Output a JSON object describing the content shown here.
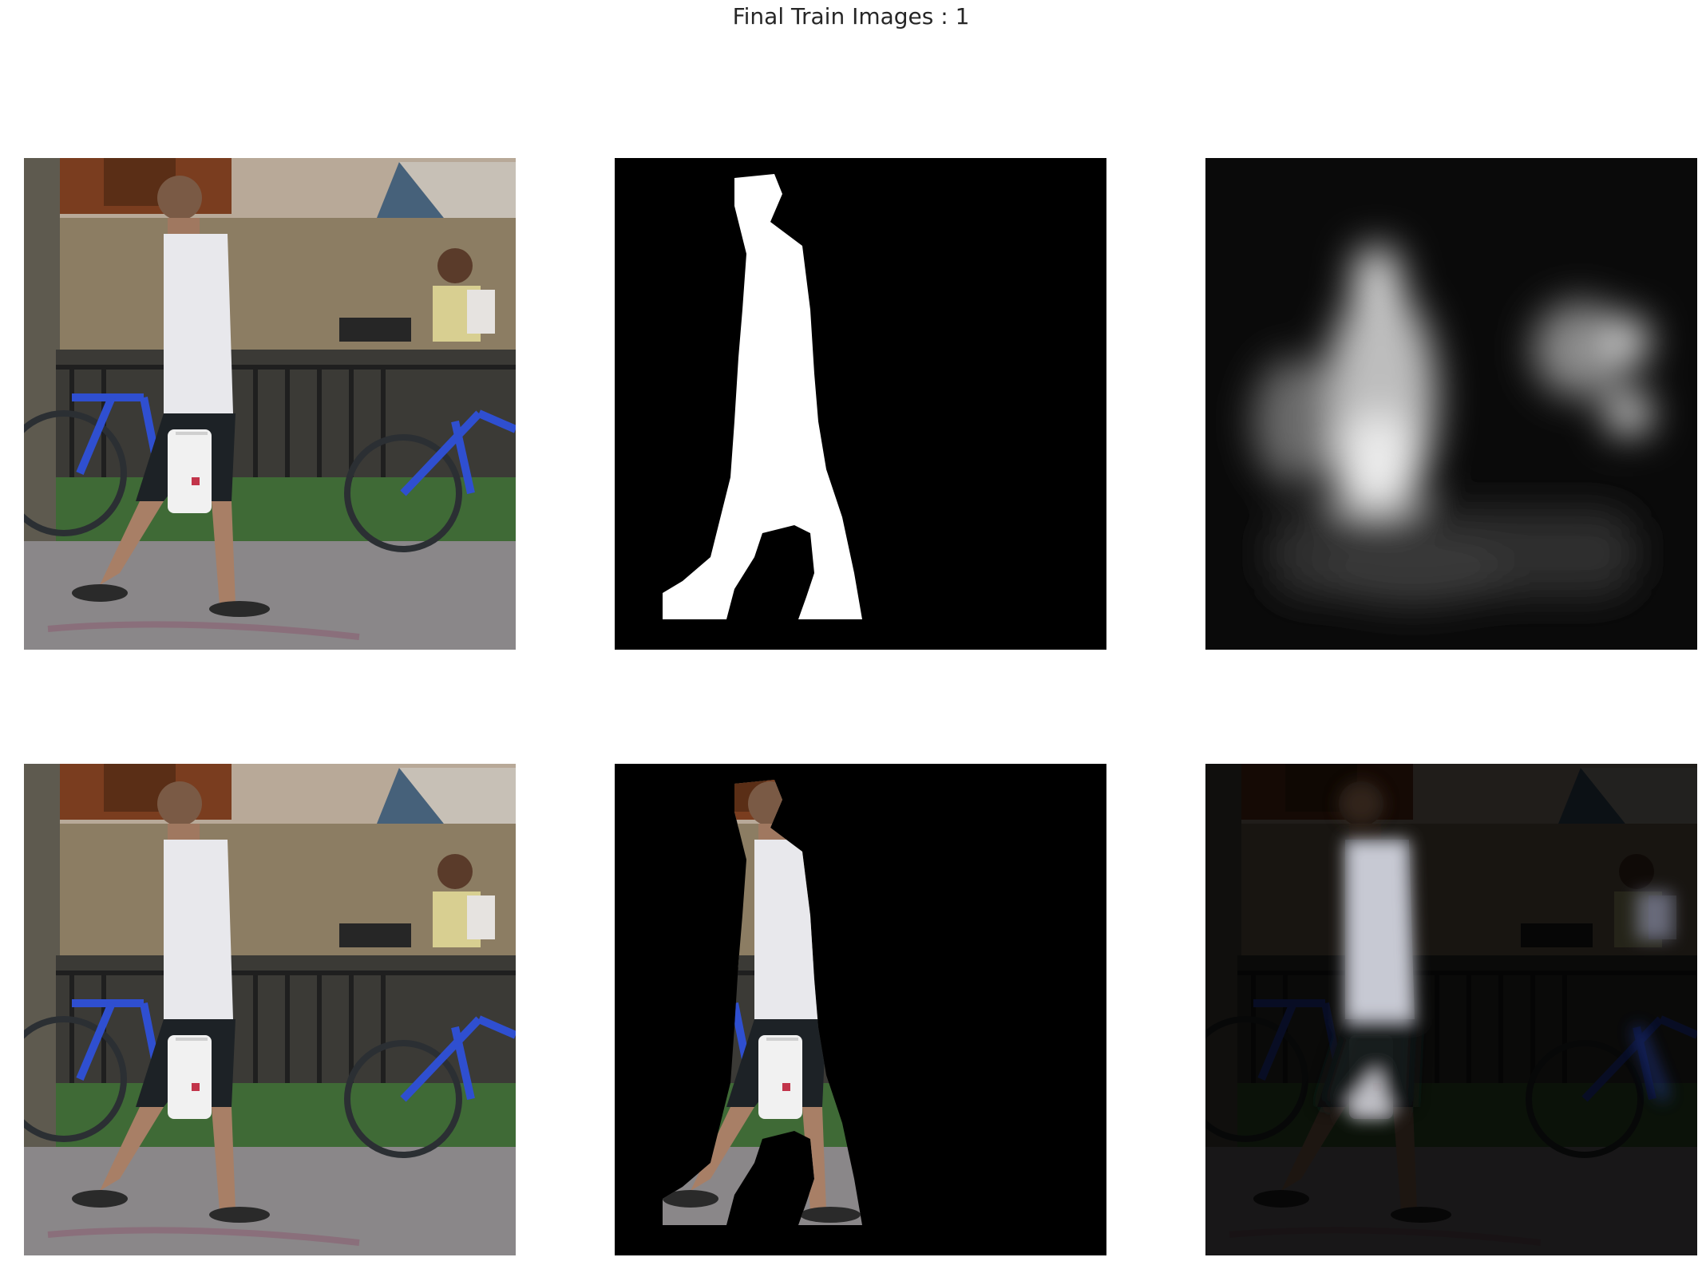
{
  "figure": {
    "title": "Final Train Images : 1",
    "grid": {
      "rows": 2,
      "cols": 3
    },
    "panels": [
      {
        "id": "input-image",
        "content": "street photo: man walking with plastic bag, bicycles and seated person in background"
      },
      {
        "id": "ground-truth-mask",
        "content": "binary silhouette of walking man (white on black)"
      },
      {
        "id": "predicted-saliency-map",
        "content": "blurred grayscale prediction, bright blobs on walking man and seated person"
      },
      {
        "id": "input-image-copy",
        "content": "same street photo as panel 1"
      },
      {
        "id": "masked-ground-truth",
        "content": "photo pixels kept only inside the ground-truth mask"
      },
      {
        "id": "masked-prediction",
        "content": "photo attenuated by predicted saliency map"
      }
    ]
  },
  "colors": {
    "background": "#ffffff",
    "title_text": "#262626",
    "shirt": "#e8e8ec",
    "shorts": "#1d2226",
    "bicycle_blue": "#2f4fd0",
    "wall": "#8c7d63",
    "ground": "#8a8789",
    "mask_fg": "#ffffff",
    "mask_bg": "#000000"
  }
}
